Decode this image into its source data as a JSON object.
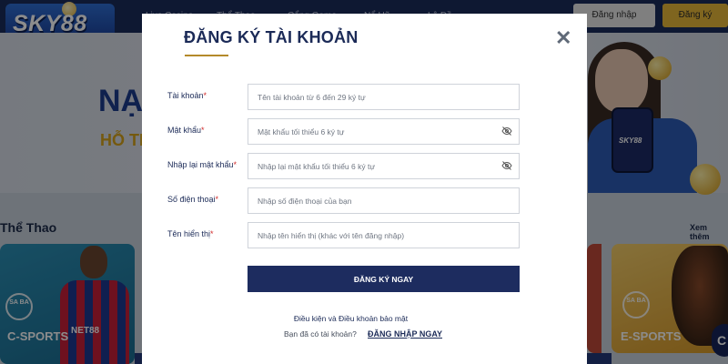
{
  "site": {
    "logo": "SKY88",
    "nav": [
      "Live Casino",
      "Thể Thao",
      "Cổng Game",
      "Nổ Hũ",
      "Lô Đề"
    ],
    "login_button": "Đăng nhập",
    "register_button": "Đăng ký",
    "hero_title": "NẠP",
    "hero_subtitle": "HỖ TR",
    "phone_brand": "SKY88",
    "section_title": "Thể Thao",
    "see_all": "Xem thêm",
    "card_left_label": "C-SPORTS",
    "card_right_label": "E-SPORTS",
    "player_shirt_text": "NET88",
    "saba_logo": "SA BA",
    "chat_icon": "chat-bubble-icon"
  },
  "modal": {
    "title": "ĐĂNG KÝ TÀI KHOẢN",
    "close_symbol": "✕",
    "fields": [
      {
        "label": "Tài khoản",
        "placeholder": "Tên tài khoản từ 6 đến 29 ký tự",
        "type": "text",
        "required_mark": "*"
      },
      {
        "label": "Mật khẩu",
        "placeholder": "Mật khẩu tối thiểu 6 ký tự",
        "type": "password",
        "required_mark": "*",
        "icon": "eye-off-icon"
      },
      {
        "label": "Nhập lại mật khẩu",
        "placeholder": "Nhập lại mật khẩu tối thiểu 6 ký tự",
        "type": "password",
        "required_mark": "*",
        "icon": "eye-off-icon"
      },
      {
        "label": "Số điện thoại",
        "placeholder": "Nhập số điện thoại của bạn",
        "type": "tel",
        "required_mark": "*"
      },
      {
        "label": "Tên hiển thị",
        "placeholder": "Nhập tên hiển thị (khác với tên đăng nhập)",
        "type": "text",
        "required_mark": "*"
      }
    ],
    "submit_label": "ĐĂNG KÝ NGAY",
    "terms_text": "Điều kiện và Điều khoản bảo mật",
    "have_account_text": "Bạn đã có tài khoản?",
    "login_link": "ĐĂNG NHẬP NGAY"
  },
  "colors": {
    "primary_navy": "#1d2c5f",
    "accent_gold": "#b48a2a",
    "required_red": "#d22c2c"
  }
}
